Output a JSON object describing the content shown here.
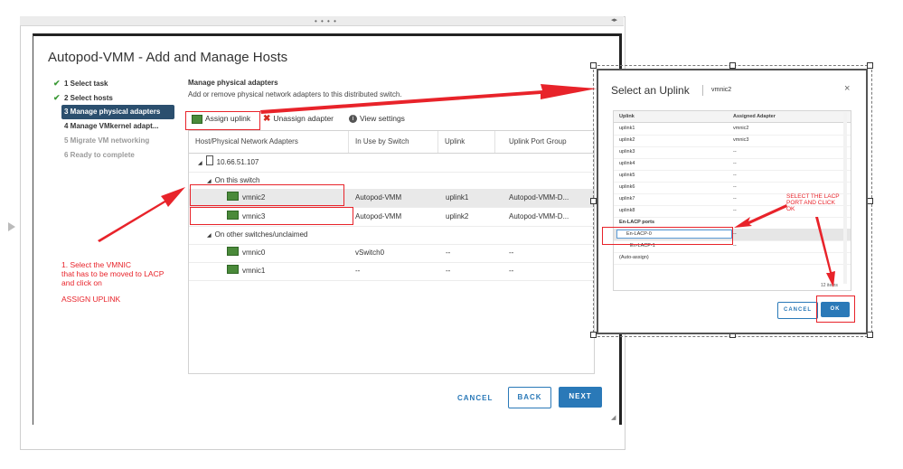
{
  "wizard": {
    "title": "Autopod-VMM - Add and Manage Hosts",
    "steps": [
      {
        "label": "1 Select task",
        "state": "done"
      },
      {
        "label": "2 Select hosts",
        "state": "done"
      },
      {
        "label": "3 Manage physical adapters",
        "state": "active"
      },
      {
        "label": "4 Manage VMkernel adapt...",
        "state": "normal"
      },
      {
        "label": "5 Migrate VM networking",
        "state": "disabled"
      },
      {
        "label": "6 Ready to complete",
        "state": "disabled"
      }
    ],
    "section_title": "Manage physical adapters",
    "section_subtitle": "Add or remove physical network adapters to this distributed switch.",
    "toolbar": {
      "assign": "Assign uplink",
      "unassign": "Unassign adapter",
      "view": "View settings"
    },
    "columns": [
      "Host/Physical Network Adapters",
      "In Use by Switch",
      "Uplink",
      "Uplink Port Group"
    ],
    "host": "10.66.51.107",
    "group_on_switch": "On this switch",
    "group_other": "On other switches/unclaimed",
    "rows_on_switch": [
      {
        "name": "vmnic2",
        "switch": "Autopod-VMM",
        "uplink": "uplink1",
        "portgroup": "Autopod-VMM-D..."
      },
      {
        "name": "vmnic3",
        "switch": "Autopod-VMM",
        "uplink": "uplink2",
        "portgroup": "Autopod-VMM-D..."
      }
    ],
    "rows_other": [
      {
        "name": "vmnic0",
        "switch": "vSwitch0",
        "uplink": "--",
        "portgroup": "--"
      },
      {
        "name": "vmnic1",
        "switch": "--",
        "uplink": "--",
        "portgroup": "--"
      }
    ],
    "buttons": {
      "cancel": "CANCEL",
      "back": "BACK",
      "next": "NEXT"
    }
  },
  "annotation_left": {
    "line1": "1. Select the VMNIC",
    "line2": "that has to be moved to LACP",
    "line3": "and click on",
    "line4": "ASSIGN UPLINK"
  },
  "dialog": {
    "title": "Select an Uplink",
    "nic": "vmnic2",
    "close": "×",
    "columns": [
      "Uplink",
      "Assigned Adapter"
    ],
    "uplinks": [
      {
        "uplink": "uplink1",
        "adapter": "vmnic2"
      },
      {
        "uplink": "uplink2",
        "adapter": "vmnic3"
      },
      {
        "uplink": "uplink3",
        "adapter": "--"
      },
      {
        "uplink": "uplink4",
        "adapter": "--"
      },
      {
        "uplink": "uplink5",
        "adapter": "--"
      },
      {
        "uplink": "uplink6",
        "adapter": "--"
      },
      {
        "uplink": "uplink7",
        "adapter": "--"
      },
      {
        "uplink": "uplink8",
        "adapter": "--"
      }
    ],
    "lacp_header": "En-LACP ports",
    "lacp_ports": [
      {
        "uplink": "En-LACP-0",
        "adapter": "--"
      },
      {
        "uplink": "En-LACP-1",
        "adapter": "--"
      }
    ],
    "auto_assign": "(Auto-assign)",
    "item_count": "12 items",
    "buttons": {
      "cancel": "CANCEL",
      "ok": "OK"
    }
  },
  "annotation_right": {
    "line1": "SELECT THE LACP",
    "line2": "PORT AND CLICK",
    "line3": "OK"
  },
  "colors": {
    "accent": "#2a79b8",
    "annotation": "#e8232a",
    "active_step": "#2b4f6e"
  }
}
